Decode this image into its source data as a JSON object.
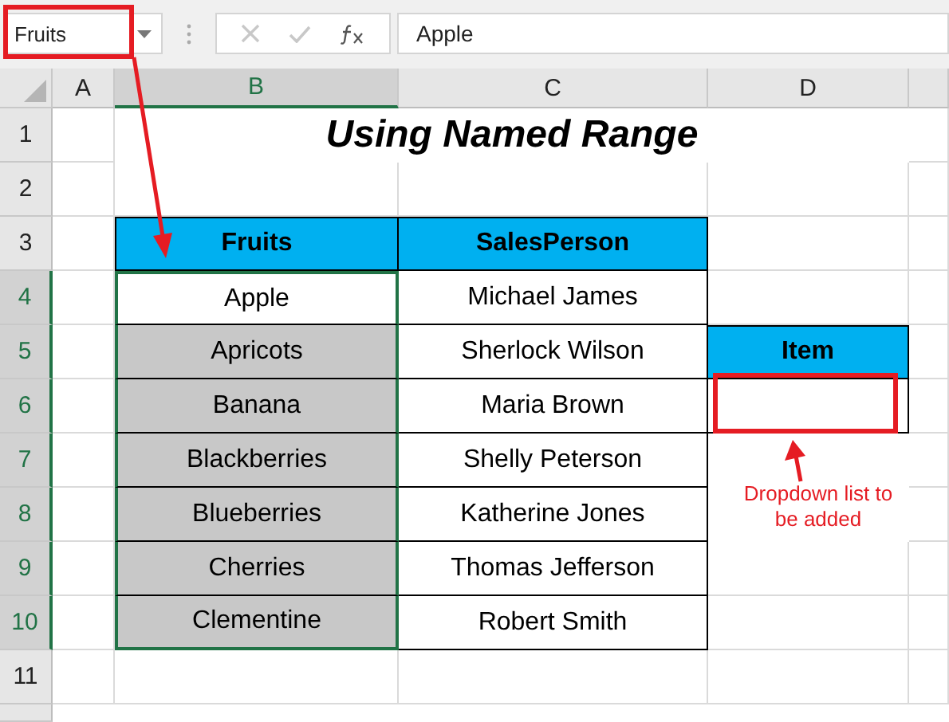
{
  "formula_bar": {
    "name_box": "Fruits",
    "formula": "Apple"
  },
  "column_headers": [
    {
      "label": "A",
      "selected": false
    },
    {
      "label": "B",
      "selected": true
    },
    {
      "label": "C",
      "selected": false
    },
    {
      "label": "D",
      "selected": false
    }
  ],
  "row_headers": [
    {
      "label": "1",
      "selected": false
    },
    {
      "label": "2",
      "selected": false
    },
    {
      "label": "3",
      "selected": false
    },
    {
      "label": "4",
      "selected": true
    },
    {
      "label": "5",
      "selected": true
    },
    {
      "label": "6",
      "selected": true
    },
    {
      "label": "7",
      "selected": true
    },
    {
      "label": "8",
      "selected": true
    },
    {
      "label": "9",
      "selected": true
    },
    {
      "label": "10",
      "selected": true
    },
    {
      "label": "11",
      "selected": false
    }
  ],
  "title": "Using Named Range",
  "table": {
    "columns": [
      "Fruits",
      "SalesPerson"
    ],
    "rows": [
      {
        "cells": [
          "Apple",
          "Michael James"
        ],
        "active": true
      },
      {
        "cells": [
          "Apricots",
          "Sherlock Wilson"
        ],
        "active": false
      },
      {
        "cells": [
          "Banana",
          "Maria Brown"
        ],
        "active": false
      },
      {
        "cells": [
          "Blackberries",
          "Shelly Peterson"
        ],
        "active": false
      },
      {
        "cells": [
          "Blueberries",
          "Katherine Jones"
        ],
        "active": false
      },
      {
        "cells": [
          "Cherries",
          "Thomas Jefferson"
        ],
        "active": false
      },
      {
        "cells": [
          "Clementine",
          "Robert Smith"
        ],
        "active": false
      }
    ]
  },
  "item": {
    "header": "Item"
  },
  "annotation": "Dropdown list to be added"
}
